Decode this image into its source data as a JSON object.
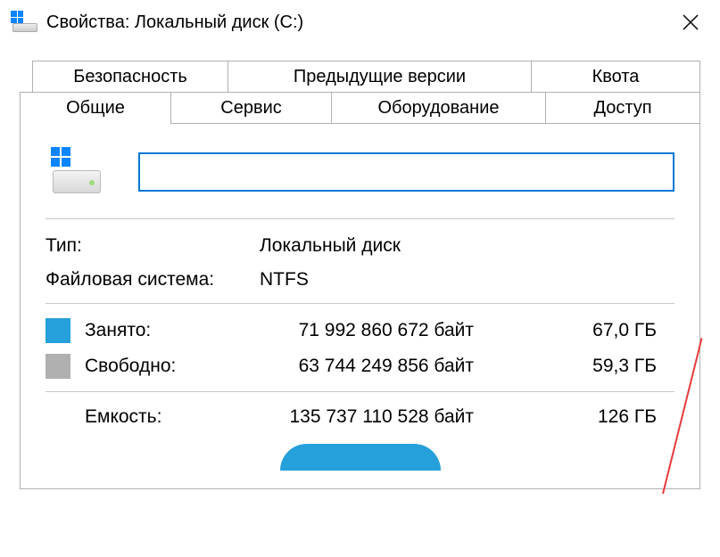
{
  "titlebar": {
    "title": "Свойства: Локальный диск (C:)"
  },
  "tabs": {
    "back": [
      {
        "label": "Безопасность"
      },
      {
        "label": "Предыдущие версии"
      },
      {
        "label": "Квота"
      }
    ],
    "front": [
      {
        "label": "Общие",
        "active": true
      },
      {
        "label": "Сервис"
      },
      {
        "label": "Оборудование"
      },
      {
        "label": "Доступ"
      }
    ]
  },
  "general": {
    "name_value": "",
    "type_label": "Тип:",
    "type_value": "Локальный диск",
    "fs_label": "Файловая система:",
    "fs_value": "NTFS",
    "used_label": "Занято:",
    "used_bytes": "71 992 860 672 байт",
    "used_gb": "67,0 ГБ",
    "used_color": "#26a0da",
    "free_label": "Свободно:",
    "free_bytes": "63 744 249 856 байт",
    "free_gb": "59,3 ГБ",
    "free_color": "#b0b0b0",
    "capacity_label": "Емкость:",
    "capacity_bytes": "135 737 110 528 байт",
    "capacity_gb": "126 ГБ"
  }
}
